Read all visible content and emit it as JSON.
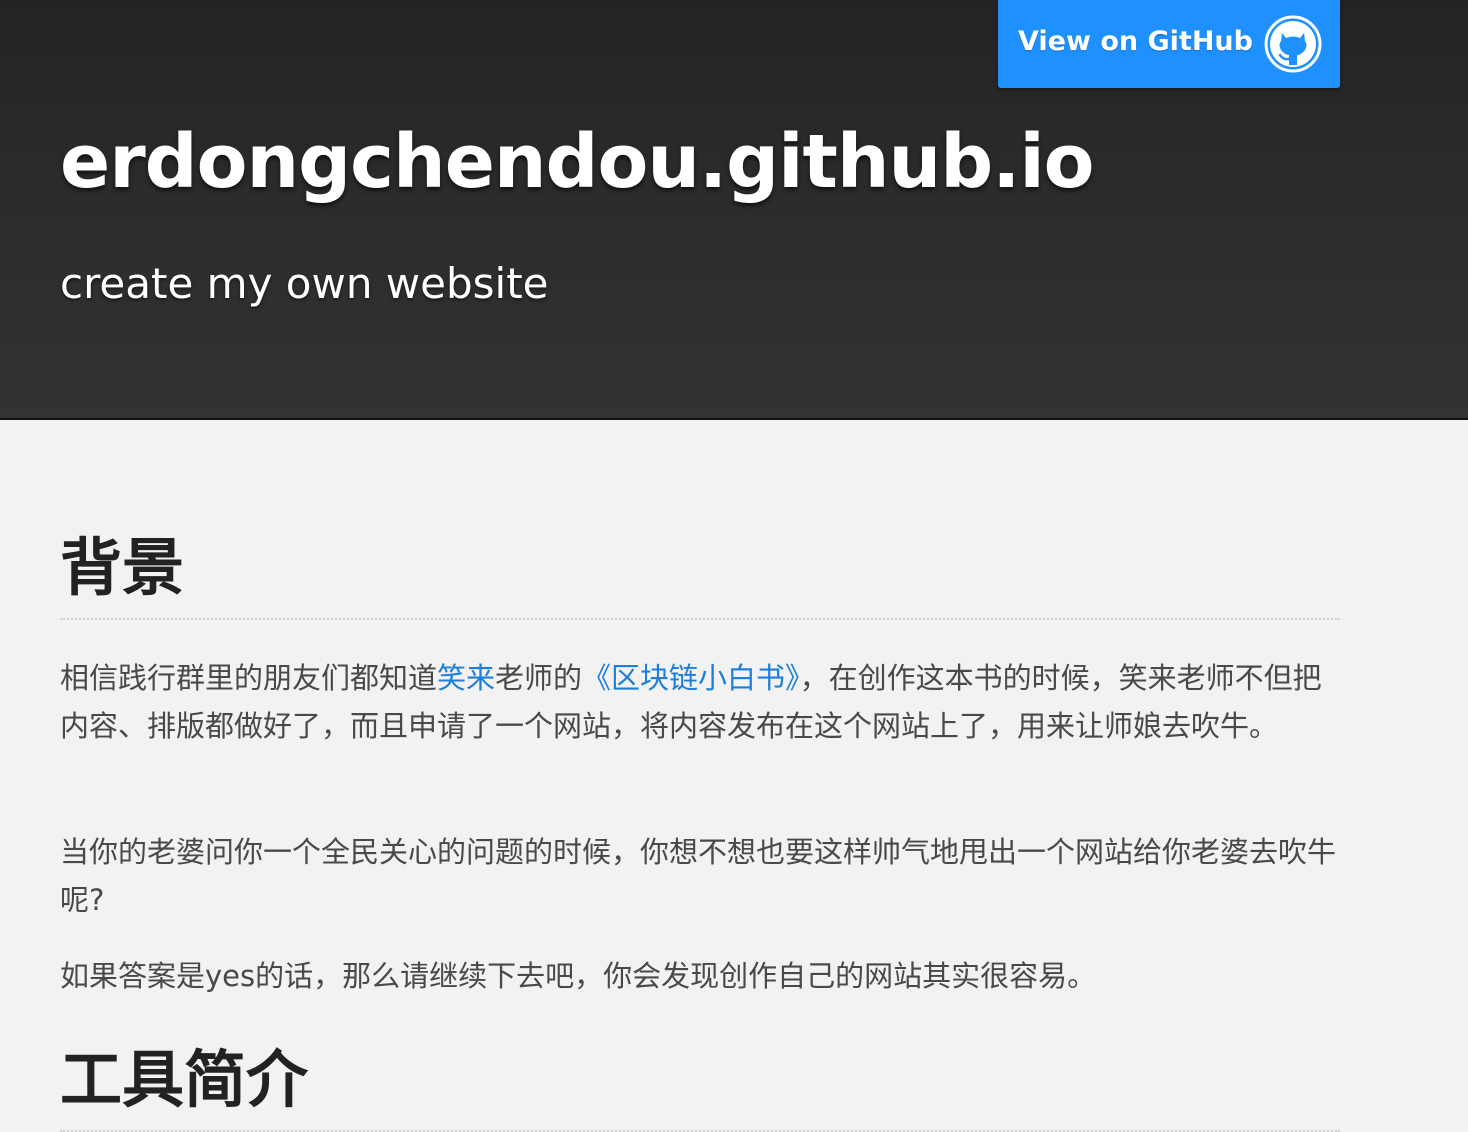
{
  "header": {
    "github_button_label": "View on GitHub",
    "github_icon": "github-octocat-icon",
    "title": "erdongchendou.github.io",
    "tagline": "create my own website"
  },
  "main": {
    "sections": [
      {
        "heading": "背景",
        "paragraphs": [
          {
            "part1": "相信践行群里的朋友们都知道",
            "link1": "笑来",
            "part2": "老师的",
            "link2": "《区块链小白书》",
            "part3": "，在创作这本书的时候，笑来老师不但把内容、排版都做好了，而且申请了一个网站，将内容发布在这个网站上了，用来让师娘去吹牛。"
          },
          {
            "text": "当你的老婆问你一个全民关心的问题的时候，你想不想也要这样帅气地甩出一个网站给你老婆去吹牛呢?"
          },
          {
            "text": "如果答案是yes的话，那么请继续下去吧，你会发现创作自己的网站其实很容易。"
          }
        ]
      },
      {
        "heading": "工具简介"
      }
    ]
  },
  "colors": {
    "header_bg": "#2b2b2b",
    "page_bg": "#f2f2f2",
    "button_bg": "#1e90ff",
    "link": "#1e7fd8",
    "heading": "#222222",
    "body_text": "#494949"
  }
}
